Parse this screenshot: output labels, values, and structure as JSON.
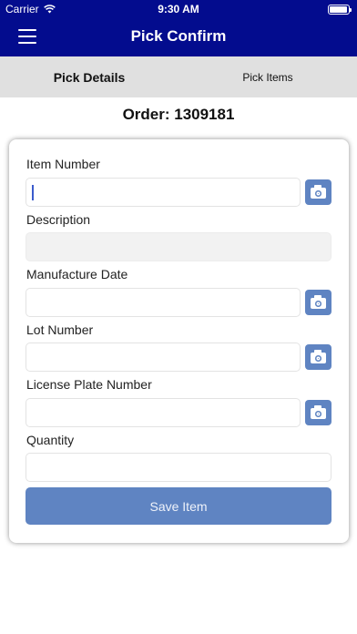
{
  "status_bar": {
    "carrier": "Carrier",
    "time": "9:30 AM"
  },
  "nav": {
    "title": "Pick Confirm"
  },
  "tabs": [
    {
      "label": "Pick Details",
      "active": true
    },
    {
      "label": "Pick Items",
      "active": false
    }
  ],
  "order": {
    "title": "Order: 1309181"
  },
  "form": {
    "item_number": {
      "label": "Item Number",
      "value": ""
    },
    "description": {
      "label": "Description",
      "value": ""
    },
    "manufacture_date": {
      "label": "Manufacture Date",
      "value": ""
    },
    "lot_number": {
      "label": "Lot Number",
      "value": ""
    },
    "license_plate_number": {
      "label": "License Plate Number",
      "value": ""
    },
    "quantity": {
      "label": "Quantity",
      "value": ""
    },
    "save_label": "Save Item"
  },
  "colors": {
    "nav_background": "#030c8e",
    "accent_button": "#5f84c2",
    "tab_bar": "#e0e0e0"
  },
  "icons": {
    "menu": "hamburger-menu-icon",
    "scan": "camera-icon",
    "wifi": "wifi-icon",
    "battery": "battery-icon"
  }
}
